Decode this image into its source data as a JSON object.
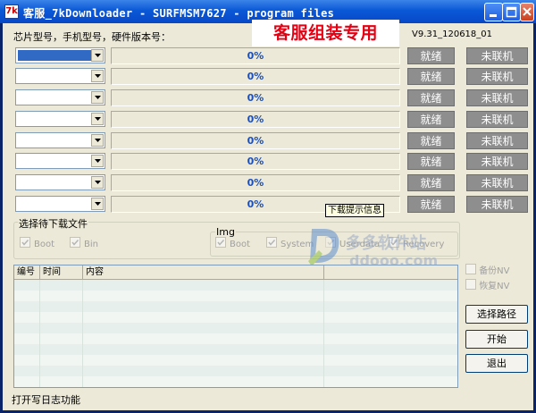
{
  "window": {
    "title": "客服_7kDownloader - SURFMSM7627 - program files",
    "icon_text": "7k"
  },
  "header": {
    "chip_label": "芯片型号，手机型号，硬件版本号：",
    "promo": "客服组装专用",
    "version": "V9.31_120618_01"
  },
  "ports": [
    {
      "progress": "0%",
      "ready": "就绪",
      "status": "未联机",
      "selected": true
    },
    {
      "progress": "0%",
      "ready": "就绪",
      "status": "未联机",
      "selected": false
    },
    {
      "progress": "0%",
      "ready": "就绪",
      "status": "未联机",
      "selected": false
    },
    {
      "progress": "0%",
      "ready": "就绪",
      "status": "未联机",
      "selected": false
    },
    {
      "progress": "0%",
      "ready": "就绪",
      "status": "未联机",
      "selected": false
    },
    {
      "progress": "0%",
      "ready": "就绪",
      "status": "未联机",
      "selected": false
    },
    {
      "progress": "0%",
      "ready": "就绪",
      "status": "未联机",
      "selected": false
    },
    {
      "progress": "0%",
      "ready": "就绪",
      "status": "未联机",
      "selected": false
    }
  ],
  "tooltip": "下载提示信息",
  "file_group": {
    "legend": "选择待下载文件",
    "boot": "Boot",
    "bin": "Bin"
  },
  "img_group": {
    "legend": "Img",
    "boot": "Boot",
    "system": "System",
    "userdata": "Userdata",
    "recovery": "Recovery"
  },
  "watermark": {
    "line1": "多多软件站",
    "line2": "ddooo.com"
  },
  "log": {
    "columns": [
      "编号",
      "时间",
      "内容"
    ],
    "row_count": 10
  },
  "side": {
    "backup": "备份NV",
    "restore": "恢复NV",
    "choose_path": "选择路径",
    "start": "开始",
    "exit": "退出"
  },
  "statusbar": "打开写日志功能",
  "colors": {
    "titlebar": "#0a58d6",
    "promo_text": "#e60012",
    "progress_text": "#1a4fbf",
    "status_button_bg": "#8e8e8e",
    "selection": "#316ac5"
  }
}
